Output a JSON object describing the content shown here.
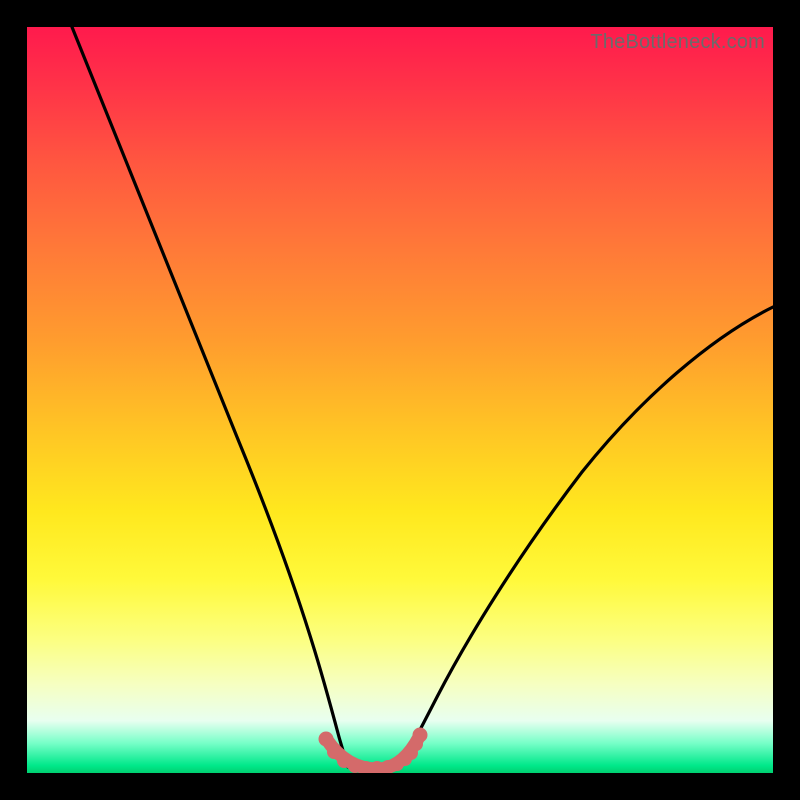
{
  "watermark": {
    "text": "TheBottleneck.com"
  },
  "chart_data": {
    "type": "line",
    "title": "",
    "xlabel": "",
    "ylabel": "",
    "xlim": [
      0,
      100
    ],
    "ylim": [
      0,
      100
    ],
    "grid": false,
    "legend": false,
    "gradient_stops": [
      {
        "pos": 0,
        "color": "#ff1a4d"
      },
      {
        "pos": 18,
        "color": "#ff5640"
      },
      {
        "pos": 42,
        "color": "#ff9c2e"
      },
      {
        "pos": 65,
        "color": "#ffe81e"
      },
      {
        "pos": 88,
        "color": "#f6ffc0"
      },
      {
        "pos": 99,
        "color": "#00e88a"
      }
    ],
    "series": [
      {
        "name": "left-curve",
        "stroke": "#000000",
        "x": [
          6,
          10,
          15,
          20,
          25,
          28,
          30,
          32,
          34,
          36,
          37.5,
          39,
          40,
          41,
          42,
          43
        ],
        "y": [
          100,
          90,
          77,
          64,
          50,
          41,
          36,
          30,
          24,
          17,
          12,
          7.5,
          5,
          3,
          1.5,
          0.8
        ]
      },
      {
        "name": "right-curve",
        "stroke": "#000000",
        "x": [
          50,
          52,
          55,
          58,
          62,
          66,
          70,
          75,
          80,
          85,
          90,
          95,
          100
        ],
        "y": [
          0.8,
          2,
          5,
          9,
          14,
          20,
          26,
          33,
          40,
          46,
          52,
          57,
          62
        ]
      },
      {
        "name": "bottom-dots",
        "stroke": "#d86a6a",
        "marker": true,
        "x": [
          40,
          41,
          42.5,
          44,
          45.5,
          47,
          48.5,
          49.5,
          50.5,
          51.3,
          52,
          52.7
        ],
        "y": [
          4.2,
          2.4,
          1.2,
          0.7,
          0.6,
          0.6,
          0.7,
          1.0,
          1.6,
          2.6,
          3.8,
          5.0
        ]
      }
    ]
  }
}
